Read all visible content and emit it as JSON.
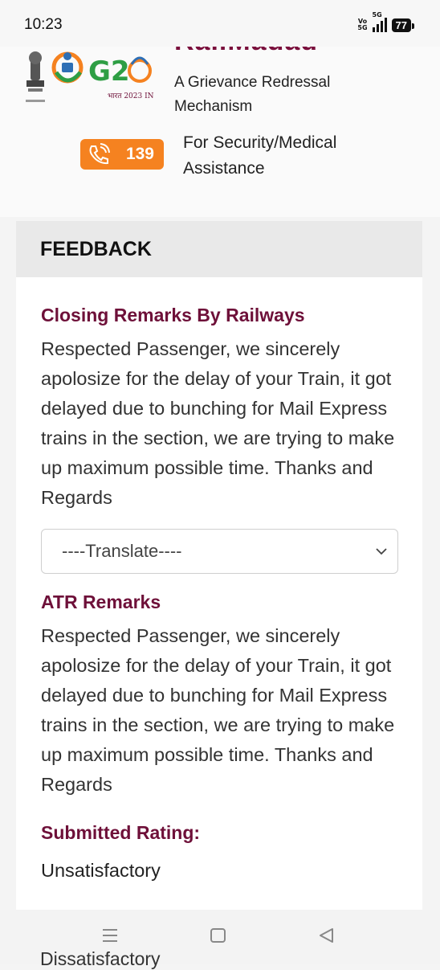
{
  "status_bar": {
    "time": "10:23",
    "network": "5G",
    "volte": "Vo 5G",
    "battery": "77"
  },
  "header": {
    "brand": "RailMadad",
    "subtitle": "A Grievance Redressal Mechanism",
    "helpline_number": "139",
    "helpline_text": "For Security/Medical Assistance"
  },
  "card": {
    "title": "FEEDBACK",
    "closing_title": "Closing Remarks By Railways",
    "closing_text": "Respected Passenger, we sincerely apolosize for the delay of your Train, it got delayed due to bunching for Mail Express trains in the section, we are trying to make up maximum possible time. Thanks and Regards",
    "translate_select": "----Translate----",
    "atr_title": "ATR Remarks",
    "atr_text": "Respected Passenger, we sincerely apolosize for the delay of your Train, it got delayed due to bunching for Mail Express trains in the section, we are trying to make up maximum possible time. Thanks and Regards",
    "rating_title": "Submitted Rating:",
    "rating_value": "Unsatisfactory",
    "next_value_peek": "Dissatisfactory"
  },
  "colors": {
    "accent": "#6e1039",
    "helpline": "#f58220"
  },
  "icons": [
    "phone-icon",
    "chevron-down-icon",
    "menu-icon",
    "home-icon",
    "back-icon"
  ]
}
